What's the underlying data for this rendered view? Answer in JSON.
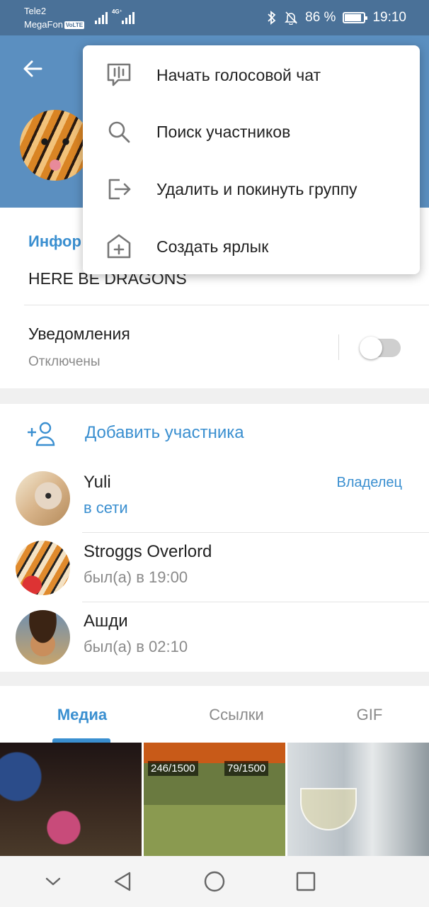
{
  "status_bar": {
    "carrier_1": "Tele2",
    "carrier_2": "MegaFon",
    "volte_badge": "VoLTE",
    "network_type": "4G⁺",
    "battery_text": "86 %",
    "battery_level_percent": 86,
    "time": "19:10",
    "icons": [
      "bluetooth-icon",
      "bell-muted-icon",
      "battery-icon"
    ]
  },
  "header": {
    "accent_color": "#5b8fc0"
  },
  "menu": {
    "items": [
      {
        "label": "Начать голосовой чат",
        "icon": "voice-chat-icon"
      },
      {
        "label": "Поиск участников",
        "icon": "search-icon"
      },
      {
        "label": "Удалить и покинуть группу",
        "icon": "leave-icon"
      },
      {
        "label": "Создать ярлык",
        "icon": "add-shortcut-icon"
      }
    ]
  },
  "info": {
    "title": "Инфор",
    "description": "HERE BE DRAGONS",
    "notifications_label": "Уведомления",
    "notifications_value": "Отключены",
    "notifications_enabled": false
  },
  "members": {
    "add_label": "Добавить участника",
    "list": [
      {
        "name": "Yuli",
        "status": "в сети",
        "role": "Владелец"
      },
      {
        "name": "Stroggs Overlord",
        "status": "был(а) в 19:00",
        "role": ""
      },
      {
        "name": "Ашди",
        "status": "был(а) в 02:10",
        "role": ""
      }
    ]
  },
  "media": {
    "tabs": [
      "Медиа",
      "Ссылки",
      "GIF"
    ],
    "active_tab": "Медиа",
    "thumb_texts": [
      "246/1500",
      "79/1500"
    ]
  },
  "colors": {
    "link_blue": "#3a8fd0",
    "status_bar": "#4a7198"
  }
}
